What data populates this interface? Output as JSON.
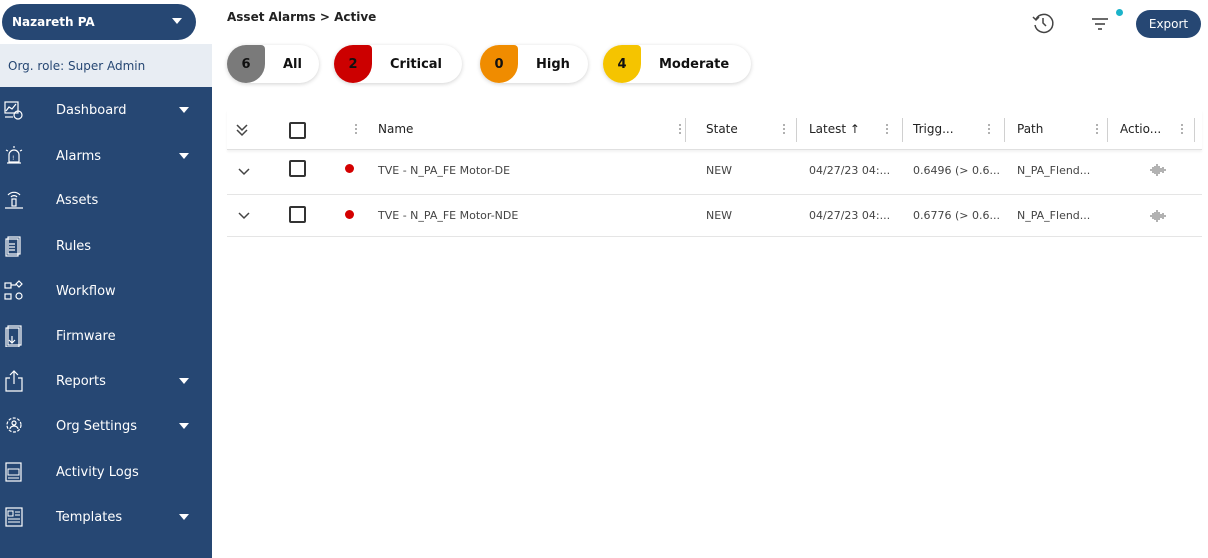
{
  "sidebar": {
    "org_name": "Nazareth PA",
    "org_role": "Org. role: Super Admin",
    "items": [
      {
        "label": "Dashboard",
        "icon": "dashboard-icon",
        "has_caret": true
      },
      {
        "label": "Alarms",
        "icon": "alarm-icon",
        "has_caret": true
      },
      {
        "label": "Assets",
        "icon": "asset-icon",
        "has_caret": false
      },
      {
        "label": "Rules",
        "icon": "rules-icon",
        "has_caret": false
      },
      {
        "label": "Workflow",
        "icon": "workflow-icon",
        "has_caret": false
      },
      {
        "label": "Firmware",
        "icon": "firmware-icon",
        "has_caret": false
      },
      {
        "label": "Reports",
        "icon": "reports-icon",
        "has_caret": true
      },
      {
        "label": "Org Settings",
        "icon": "org-settings-icon",
        "has_caret": true
      },
      {
        "label": "Activity Logs",
        "icon": "activity-logs-icon",
        "has_caret": false
      },
      {
        "label": "Templates",
        "icon": "templates-icon",
        "has_caret": true
      }
    ]
  },
  "header": {
    "breadcrumb": "Asset Alarms > Active",
    "export_label": "Export"
  },
  "filters": [
    {
      "count": "6",
      "label": "All",
      "color": "#7a7a7a"
    },
    {
      "count": "2",
      "label": "Critical",
      "color": "#cc0000"
    },
    {
      "count": "0",
      "label": "High",
      "color": "#f08c00"
    },
    {
      "count": "4",
      "label": "Moderate",
      "color": "#f5c400"
    }
  ],
  "table": {
    "columns": {
      "name": "Name",
      "state": "State",
      "latest": "Latest ↑",
      "triggered": "Trigg...",
      "path": "Path",
      "actions": "Actio..."
    },
    "rows": [
      {
        "name": "TVE - N_PA_FE Motor-DE",
        "state": "NEW",
        "latest": "04/27/23 04:...",
        "triggered": "0.6496 (> 0.6...",
        "path": "N_PA_Flend..."
      },
      {
        "name": "TVE - N_PA_FE Motor-NDE",
        "state": "NEW",
        "latest": "04/27/23 04:...",
        "triggered": "0.6776 (> 0.6...",
        "path": "N_PA_Flend..."
      }
    ]
  },
  "colors": {
    "sidebar": "#264773",
    "accent_dot": "#1bb3c9",
    "critical": "#d40000"
  }
}
